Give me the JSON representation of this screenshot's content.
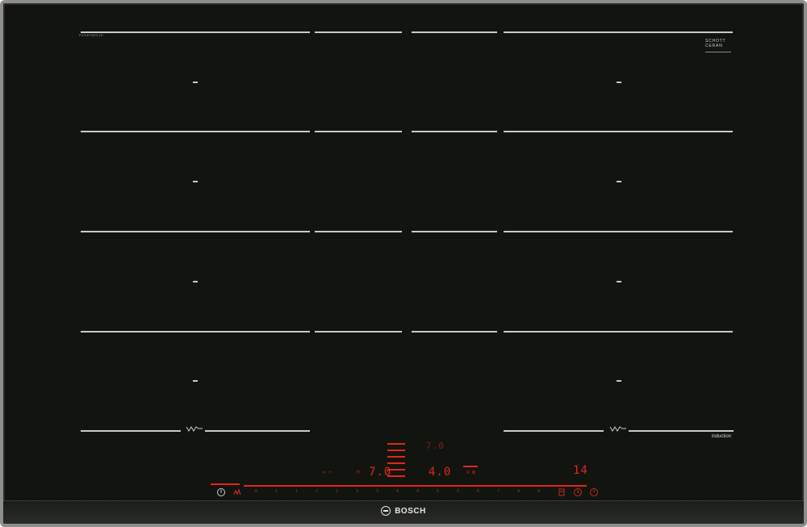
{
  "hob": {
    "model_code": "PXX875DC1E",
    "schott_label_line1": "SCHOTT",
    "schott_label_line2": "CERAN",
    "induction_label": "induction",
    "brand": "BOSCH"
  },
  "controls": {
    "display_top": "7.0",
    "display_timer_left": "7.0",
    "display_timer_mid": "4.0",
    "display_right": "14",
    "scale_ticks": [
      "0",
      "1",
      "1",
      "2",
      "2",
      "3",
      "3",
      "4",
      "4",
      "5",
      "5",
      "6",
      "7",
      "8",
      "9"
    ],
    "icons": [
      "power-icon",
      "zone-icon",
      "flex-icon",
      "timer-icon",
      "lock-icon",
      "sensor-icon",
      "clock-icon"
    ]
  },
  "colors": {
    "glass": "#121410",
    "frame": "#8e8f8d",
    "line": "#c9cbc7",
    "display_red": "#e3271a"
  }
}
